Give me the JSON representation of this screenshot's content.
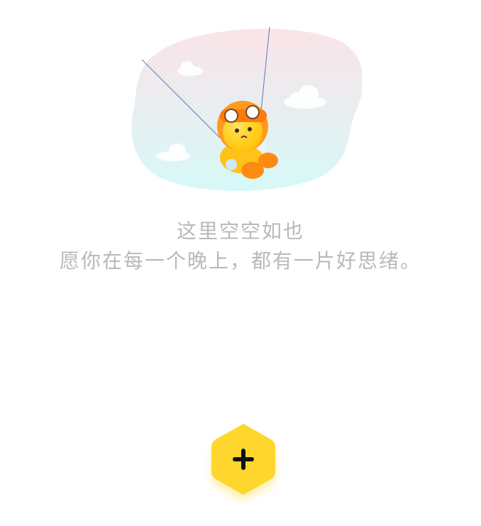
{
  "empty_state": {
    "title": "这里空空如也",
    "subtitle": "愿你在每一个晚上，都有一片好思绪。",
    "illustration": "mascot-swinging-in-sky"
  },
  "fab": {
    "icon": "plus-icon",
    "color": "#ffd62e"
  },
  "colors": {
    "text_muted": "#b9b9b9",
    "cloud_top": "#fbe3e8",
    "cloud_bottom": "#d8f8f9",
    "mascot_yellow": "#ffd21a",
    "mascot_orange": "#ff9a1e"
  }
}
